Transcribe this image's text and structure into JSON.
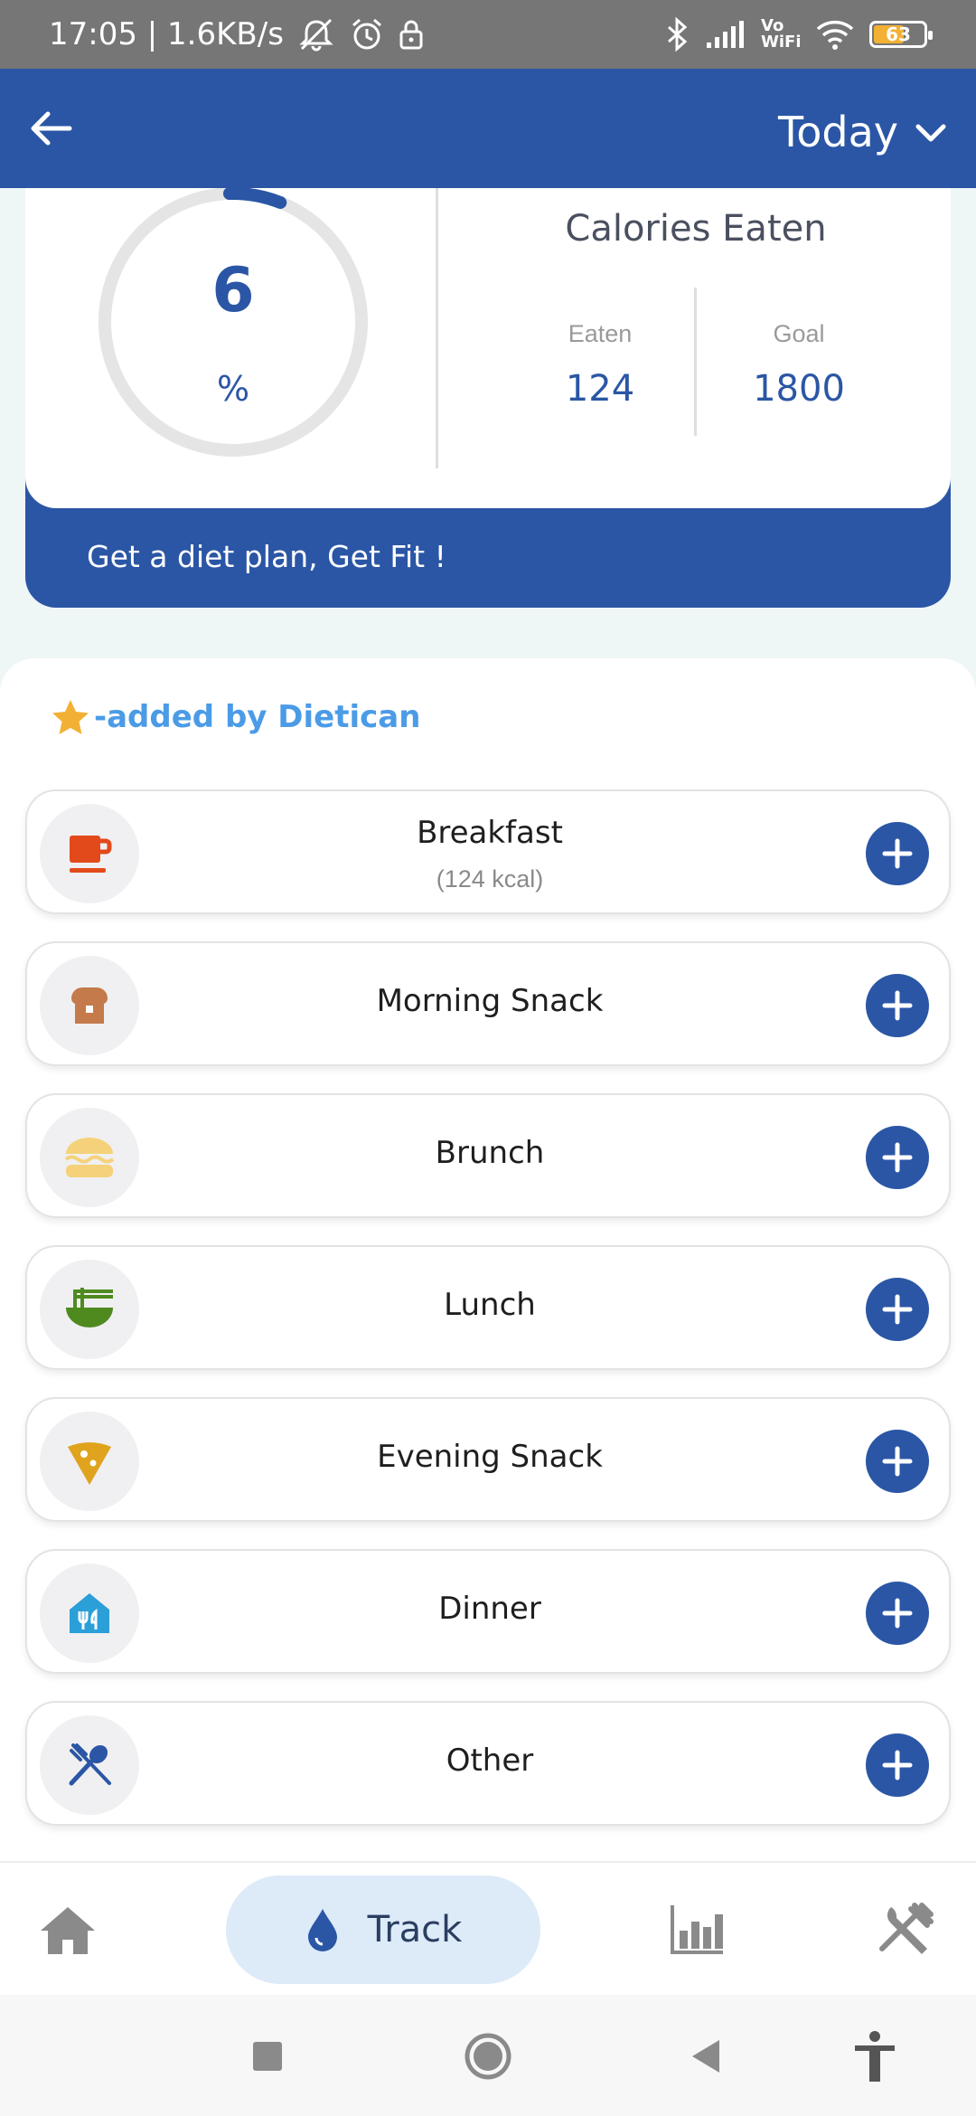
{
  "status_bar": {
    "time_speed": "17:05 | 1.6KB/s",
    "network_label": "Vo WiFi",
    "battery_percent": "63",
    "battery_level": 0.63
  },
  "app_bar": {
    "date_label": "Today"
  },
  "calories": {
    "percent_value": "6",
    "percent_unit": "%",
    "progress_fraction": 0.06,
    "title": "Calories Eaten",
    "eaten_label": "Eaten",
    "eaten_value": "124",
    "goal_label": "Goal",
    "goal_value": "1800"
  },
  "banner": {
    "text": "Get a diet plan, Get Fit !"
  },
  "legend": {
    "text": "-added by Dietican"
  },
  "meals": [
    {
      "name": "Breakfast",
      "kcal": "(124 kcal)",
      "icon": "coffee-cup-icon"
    },
    {
      "name": "Morning Snack",
      "kcal": "",
      "icon": "toast-icon"
    },
    {
      "name": "Brunch",
      "kcal": "",
      "icon": "burger-icon"
    },
    {
      "name": "Lunch",
      "kcal": "",
      "icon": "noodle-bowl-icon"
    },
    {
      "name": "Evening Snack",
      "kcal": "",
      "icon": "pizza-slice-icon"
    },
    {
      "name": "Dinner",
      "kcal": "",
      "icon": "restaurant-icon"
    },
    {
      "name": "Other",
      "kcal": "",
      "icon": "fork-spoon-icon"
    }
  ],
  "bottom_nav": {
    "track_label": "Track",
    "items": [
      "home-icon",
      "water-drop-icon",
      "bar-chart-icon",
      "utensils-icon"
    ]
  },
  "colors": {
    "primary": "#2b56a5",
    "accent_blue": "#4b9be6",
    "star": "#f2b134"
  }
}
